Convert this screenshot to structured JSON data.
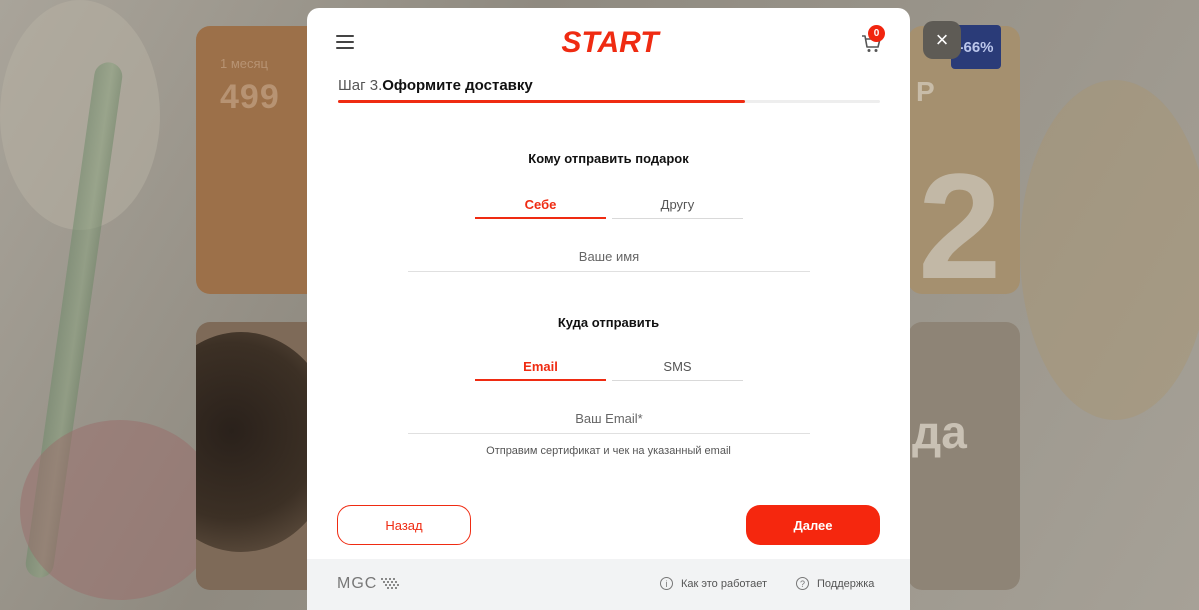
{
  "background": {
    "card1_text": "1 месяц",
    "card1_price": "499",
    "card3_price": "Р",
    "card3_big": "2",
    "card4_text": "да",
    "discount_badge": "-66%"
  },
  "modal": {
    "close_icon": "×",
    "logo_text": "START",
    "cart_count": "0",
    "step": {
      "number": "Шаг 3.",
      "title": "Оформите доставку",
      "progress": 0.75
    },
    "recipient": {
      "title": "Кому отправить подарок",
      "tabs": [
        {
          "label": "Себе",
          "active": true
        },
        {
          "label": "Другу",
          "active": false
        }
      ],
      "name_placeholder": "Ваше имя"
    },
    "destination": {
      "title": "Куда отправить",
      "tabs": [
        {
          "label": "Email",
          "active": true
        },
        {
          "label": "SMS",
          "active": false
        }
      ],
      "email_placeholder": "Ваш Email*",
      "hint": "Отправим сертификат и чек на указанный email"
    },
    "buttons": {
      "back": "Назад",
      "next": "Далее"
    },
    "footer": {
      "brand": "MGC",
      "how_it_works": "Как это работает",
      "support": "Поддержка",
      "info_icon": "i",
      "help_icon": "?"
    }
  },
  "colors": {
    "accent": "#ef2b12",
    "overlay": "#6d6a63"
  }
}
